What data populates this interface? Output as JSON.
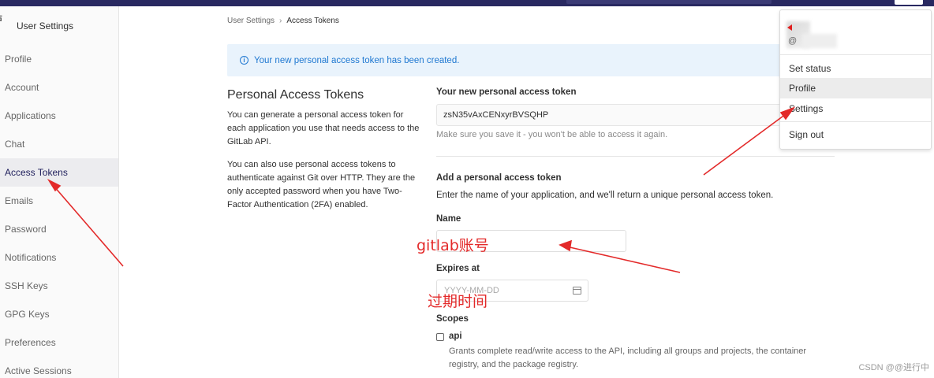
{
  "topbar": {
    "corner_icon": "user-avatar-icon"
  },
  "sidebar": {
    "header_icon_text": "占",
    "title": "User Settings",
    "items": [
      {
        "label": "Profile",
        "active": false
      },
      {
        "label": "Account",
        "active": false
      },
      {
        "label": "Applications",
        "active": false
      },
      {
        "label": "Chat",
        "active": false
      },
      {
        "label": "Access Tokens",
        "active": true
      },
      {
        "label": "Emails",
        "active": false
      },
      {
        "label": "Password",
        "active": false
      },
      {
        "label": "Notifications",
        "active": false
      },
      {
        "label": "SSH Keys",
        "active": false
      },
      {
        "label": "GPG Keys",
        "active": false
      },
      {
        "label": "Preferences",
        "active": false
      },
      {
        "label": "Active Sessions",
        "active": false
      }
    ]
  },
  "breadcrumb": {
    "parent": "User Settings",
    "separator": "›",
    "current": "Access Tokens"
  },
  "alert": {
    "icon": "info-icon",
    "text": "Your new personal access token has been created."
  },
  "intro": {
    "title": "Personal Access Tokens",
    "p1": "You can generate a personal access token for each application you use that needs access to the GitLab API.",
    "p2": "You can also use personal access tokens to authenticate against Git over HTTP. They are the only accepted password when you have Two-Factor Authentication (2FA) enabled."
  },
  "new_token": {
    "label": "Your new personal access token",
    "value": "zsN35vAxCENxyrBVSQHP",
    "help": "Make sure you save it - you won't be able to access it again."
  },
  "form": {
    "heading": "Add a personal access token",
    "description": "Enter the name of your application, and we'll return a unique personal access token.",
    "name_label": "Name",
    "name_value": "",
    "expires_label": "Expires at",
    "expires_placeholder": "YYYY-MM-DD",
    "scopes_label": "Scopes",
    "scope_api_label": "api",
    "scope_api_desc": "Grants complete read/write access to the API, including all groups and projects, the container registry, and the package registry."
  },
  "dropdown": {
    "handle": "@",
    "items": [
      "Set status",
      "Profile",
      "Settings",
      "Sign out"
    ]
  },
  "annotations": {
    "name_note": "gitlab账号",
    "expires_note": "过期时间",
    "arrow_color": "#e32a2a"
  },
  "watermark": "CSDN @@进行中"
}
